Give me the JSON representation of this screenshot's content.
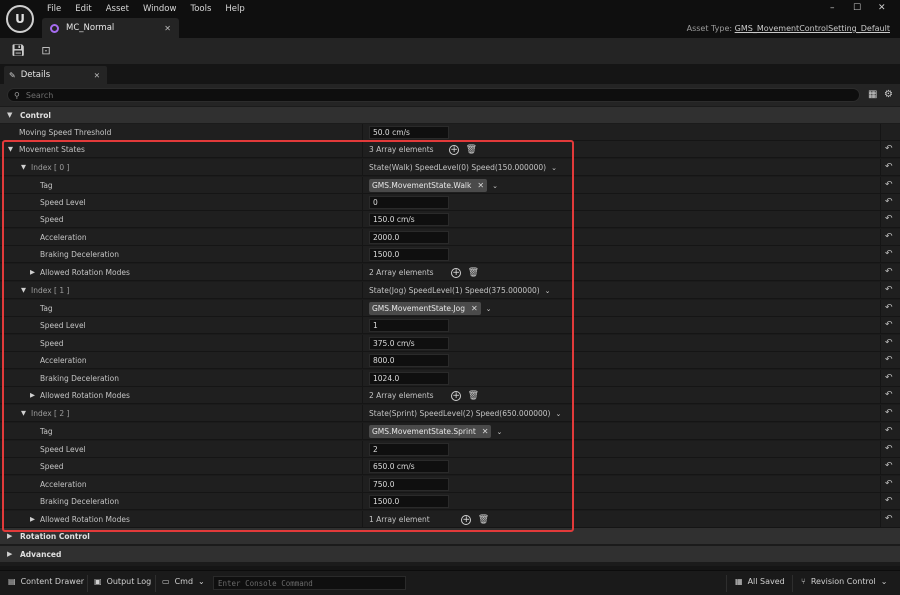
{
  "menu": [
    "File",
    "Edit",
    "Asset",
    "Window",
    "Tools",
    "Help"
  ],
  "window_controls": {
    "minimize": "–",
    "maximize": "☐",
    "close": "✕"
  },
  "doc_tab": {
    "label": "MC_Normal",
    "close": "✕"
  },
  "asset_type": {
    "label": "Asset Type:",
    "value": "GMS_MovementControlSetting_Default"
  },
  "details_tab": {
    "label": "Details",
    "close": "✕"
  },
  "search": {
    "placeholder": "Search"
  },
  "categories": {
    "control": "Control",
    "rotation_control": "Rotation Control",
    "advanced": "Advanced"
  },
  "moving_speed_threshold": {
    "label": "Moving Speed Threshold",
    "value": "50.0 cm/s"
  },
  "movement_states": {
    "label": "Movement States",
    "summary": "3 Array elements"
  },
  "property_labels": {
    "tag": "Tag",
    "speed_level": "Speed Level",
    "speed": "Speed",
    "acceleration": "Acceleration",
    "braking": "Braking Deceleration",
    "rotation_modes": "Allowed Rotation Modes"
  },
  "states": [
    {
      "index": "Index [ 0 ]",
      "summary": "State(Walk) SpeedLevel(0) Speed(150.000000)",
      "tag": "GMS.MovementState.Walk",
      "speed_level": "0",
      "speed": "150.0 cm/s",
      "acceleration": "2000.0",
      "braking": "1500.0",
      "rotation_modes": "2 Array elements"
    },
    {
      "index": "Index [ 1 ]",
      "summary": "State(Jog) SpeedLevel(1) Speed(375.000000)",
      "tag": "GMS.MovementState.Jog",
      "speed_level": "1",
      "speed": "375.0 cm/s",
      "acceleration": "800.0",
      "braking": "1024.0",
      "rotation_modes": "2 Array elements"
    },
    {
      "index": "Index [ 2 ]",
      "summary": "State(Sprint) SpeedLevel(2) Speed(650.000000)",
      "tag": "GMS.MovementState.Sprint",
      "speed_level": "2",
      "speed": "650.0 cm/s",
      "acceleration": "750.0",
      "braking": "1500.0",
      "rotation_modes": "1 Array element"
    }
  ],
  "statusbar": {
    "content_drawer": "Content Drawer",
    "output_log": "Output Log",
    "cmd": "Cmd",
    "console_placeholder": "Enter Console Command",
    "all_saved": "All Saved",
    "revision_control": "Revision Control"
  },
  "highlight_color": "#e23a3a",
  "accent_color": "#a66cf0"
}
